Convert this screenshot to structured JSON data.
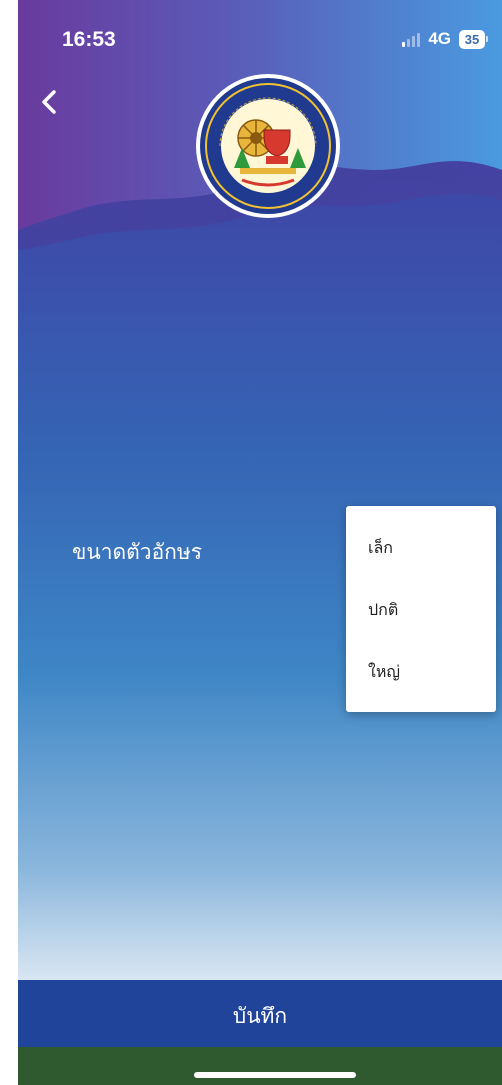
{
  "status_bar": {
    "time": "16:53",
    "network": "4G",
    "battery": "35"
  },
  "header": {
    "logo_icon": "cooperative-seal-logo-icon",
    "back_icon": "chevron-left-icon"
  },
  "settings": {
    "font_size_label": "ขนาดตัวอักษร"
  },
  "font_size_menu": {
    "options": [
      "เล็ก",
      "ปกติ",
      "ใหญ่"
    ]
  },
  "footer": {
    "save_label": "บันทึก"
  },
  "colors": {
    "save_bar": "#21449b",
    "bottom_strip": "#2f5a2f",
    "header_purple": "#6a3a9e",
    "header_blue": "#4a8fd8"
  }
}
